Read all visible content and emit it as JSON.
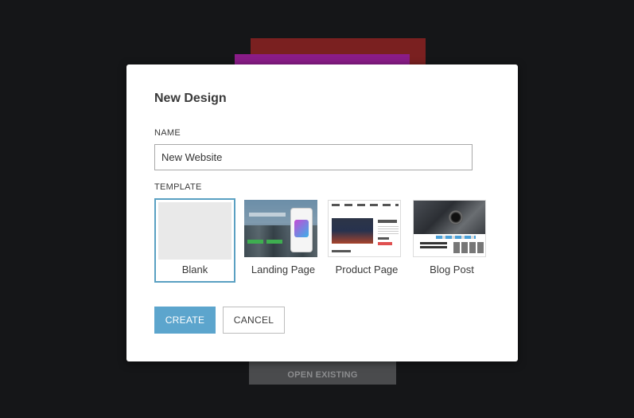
{
  "background": {
    "open_existing_label": "OPEN EXISTING"
  },
  "dialog": {
    "title": "New Design",
    "name_label": "NAME",
    "name_value": "New Website",
    "template_label": "TEMPLATE",
    "templates": [
      {
        "label": "Blank",
        "selected": true
      },
      {
        "label": "Landing Page",
        "selected": false
      },
      {
        "label": "Product Page",
        "selected": false
      },
      {
        "label": "Blog Post",
        "selected": false
      }
    ],
    "create_label": "CREATE",
    "cancel_label": "CANCEL"
  },
  "colors": {
    "accent": "#5ca5cd",
    "selected_border": "#5aa0c2",
    "backdrop": "#151618"
  }
}
